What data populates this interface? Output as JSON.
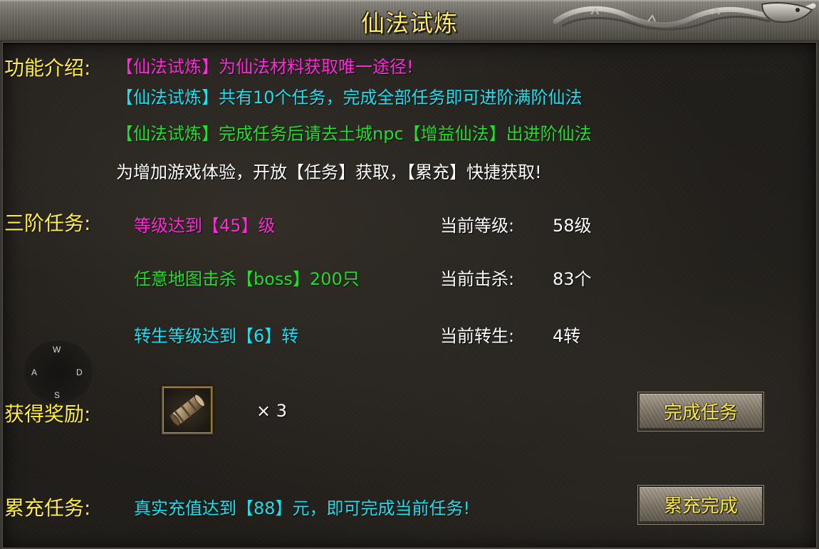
{
  "title": "仙法试炼",
  "intro": {
    "label": "功能介绍:",
    "lines": [
      "【仙法试炼】为仙法材料获取唯一途径!",
      "【仙法试炼】共有10个任务，完成全部任务即可进阶满阶仙法",
      "【仙法试炼】完成任务后请去土城npc【增益仙法】出进阶仙法",
      "为增加游戏体验，开放【任务】获取，【累充】快捷获取!"
    ]
  },
  "quest": {
    "label": "三阶任务:",
    "tasks": [
      {
        "requirement": "等级达到【45】级",
        "progress_label": "当前等级:",
        "progress_value": "58级"
      },
      {
        "requirement": "任意地图击杀【boss】200只",
        "progress_label": "当前击杀:",
        "progress_value": "83个"
      },
      {
        "requirement": "转生等级达到【6】转",
        "progress_label": "当前转生:",
        "progress_value": "4转"
      }
    ]
  },
  "reward": {
    "label": "获得奖励:",
    "item_icon": "scroll-item-icon",
    "quantity": "× 3",
    "button_label": "完成任务"
  },
  "recharge": {
    "label": "累充任务:",
    "text": "真实充值达到【88】元，即可完成当前任务!",
    "button_label": "累充完成"
  },
  "compass": {
    "n": "W",
    "w": "A",
    "e": "D",
    "s": "S"
  },
  "colors": {
    "label_yellow": "#ffef3b",
    "magenta": "#ff2ad9",
    "cyan": "#19e1f0",
    "green": "#1fe02a",
    "button_text": "#ffec3a"
  }
}
